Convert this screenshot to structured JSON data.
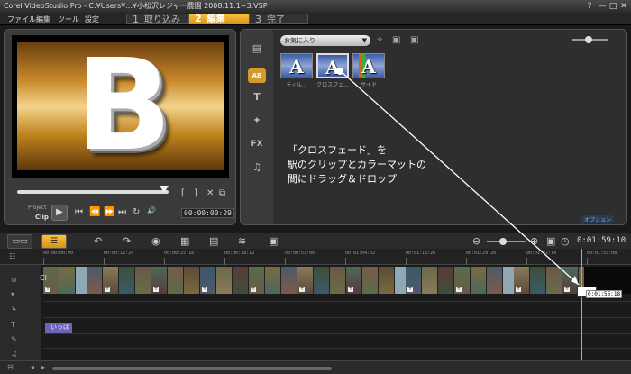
{
  "window": {
    "title": "Corel VideoStudio Pro - C:¥Users¥...¥小松沢レジャー農園 2008.11.1~3.VSP",
    "controls": [
      "?",
      "—",
      "□",
      "✕"
    ]
  },
  "menu": [
    "ファイル",
    "編集",
    "ツール",
    "設定"
  ],
  "steps": [
    {
      "num": "1",
      "label": "取り込み"
    },
    {
      "num": "2",
      "label": "編集"
    },
    {
      "num": "3",
      "label": "完了"
    }
  ],
  "preview": {
    "big_letter": "B",
    "project_label": "Project",
    "clip_label": "Clip",
    "timecode": "00:00:00:29",
    "controls": [
      "⏮",
      "⏪",
      "⏩",
      "⏭",
      "↻",
      "🔊"
    ],
    "edit_marks": [
      "[",
      "]",
      "✕",
      "⧉"
    ]
  },
  "library": {
    "dropdown": "お気に入り",
    "thumbs": [
      {
        "letter": "A",
        "label": "ティル..."
      },
      {
        "letter": "A",
        "label": "クロスフェ..."
      },
      {
        "letter": "A",
        "label": "サイド"
      }
    ],
    "annotation": [
      "「クロスフェード」を",
      "駅のクリップとカラーマットの",
      "間にドラッグ＆ドロップ"
    ],
    "options_button": "オプション",
    "side_icons": [
      "▤",
      "AB",
      "T",
      "✦",
      "FX",
      "♫"
    ]
  },
  "timeline": {
    "timecode": "0:01:59:10",
    "ruler": [
      "00:00:00:00",
      "00:00:12:24",
      "00:00:25:18",
      "00:00:38:12",
      "00:00:51:06",
      "00:01:04:02",
      "00:01:16:26",
      "00:01:29:20",
      "00:01:42:14",
      "00:01:55:08"
    ],
    "clip_text": "Cl",
    "title_clip": "いっぱ",
    "drop_time": "0:01:56:18"
  }
}
